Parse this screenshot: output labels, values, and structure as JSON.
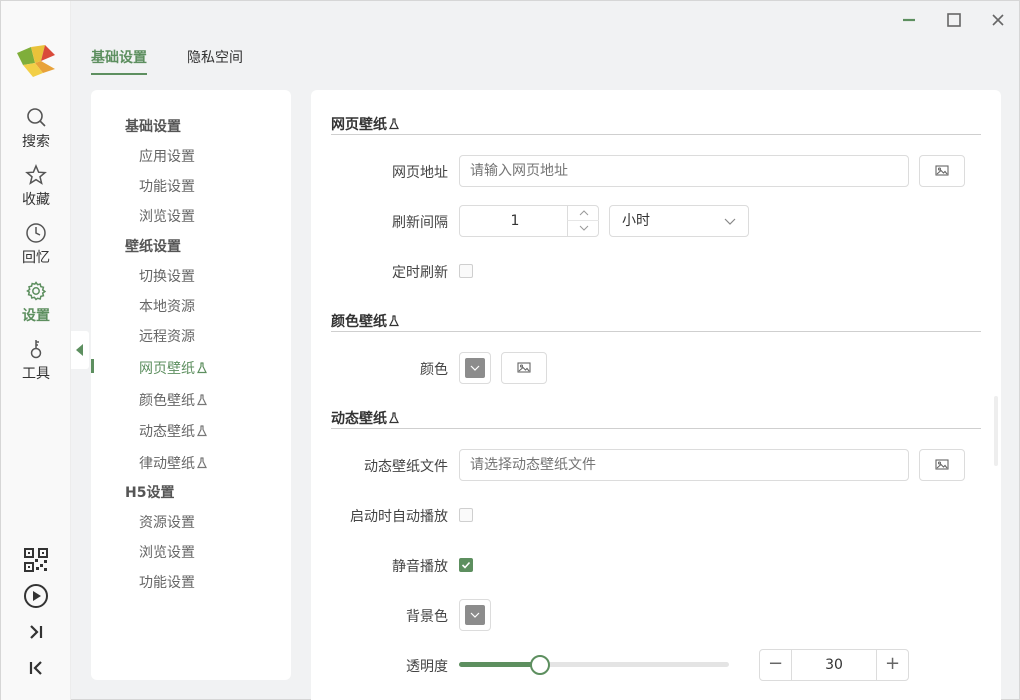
{
  "window": {
    "controls": [
      "minimize-icon",
      "maximize-icon",
      "close-icon"
    ]
  },
  "rail": {
    "items": [
      {
        "label": "搜索",
        "icon": "search-icon"
      },
      {
        "label": "收藏",
        "icon": "star-icon"
      },
      {
        "label": "回忆",
        "icon": "clock-icon"
      },
      {
        "label": "设置",
        "icon": "gear-icon",
        "active": true
      },
      {
        "label": "工具",
        "icon": "tool-icon"
      }
    ],
    "bottom_buttons": [
      "qr-code-icon",
      "play-icon",
      "next-icon",
      "previous-icon"
    ]
  },
  "tabs": [
    {
      "label": "基础设置",
      "active": true
    },
    {
      "label": "隐私空间",
      "active": false
    }
  ],
  "tree": {
    "groups": [
      {
        "label": "基础设置",
        "items": [
          "应用设置",
          "功能设置",
          "浏览设置"
        ]
      },
      {
        "label": "壁纸设置",
        "items": [
          "切换设置",
          "本地资源",
          "远程资源",
          "网页壁纸",
          "颜色壁纸",
          "动态壁纸",
          "律动壁纸"
        ]
      },
      {
        "label": "H5设置",
        "items": [
          "资源设置",
          "浏览设置",
          "功能设置"
        ]
      }
    ],
    "active_item": "网页壁纸"
  },
  "sections": {
    "web": {
      "title": "网页壁纸",
      "url_label": "网页地址",
      "url_placeholder": "请输入网页地址",
      "interval_label": "刷新间隔",
      "interval_value": "1",
      "interval_unit": "小时",
      "timed_refresh_label": "定时刷新",
      "timed_refresh_checked": false
    },
    "color": {
      "title": "颜色壁纸",
      "color_label": "颜色",
      "swatch": "#8c8c8c"
    },
    "dynamic": {
      "title": "动态壁纸",
      "file_label": "动态壁纸文件",
      "file_placeholder": "请选择动态壁纸文件",
      "autoplay_label": "启动时自动播放",
      "autoplay_checked": false,
      "mute_label": "静音播放",
      "mute_checked": true,
      "bg_label": "背景色",
      "opacity_label": "透明度",
      "opacity_value": "30",
      "opacity_fraction": 0.3
    }
  },
  "colors": {
    "accent": "#5d8f5f"
  }
}
